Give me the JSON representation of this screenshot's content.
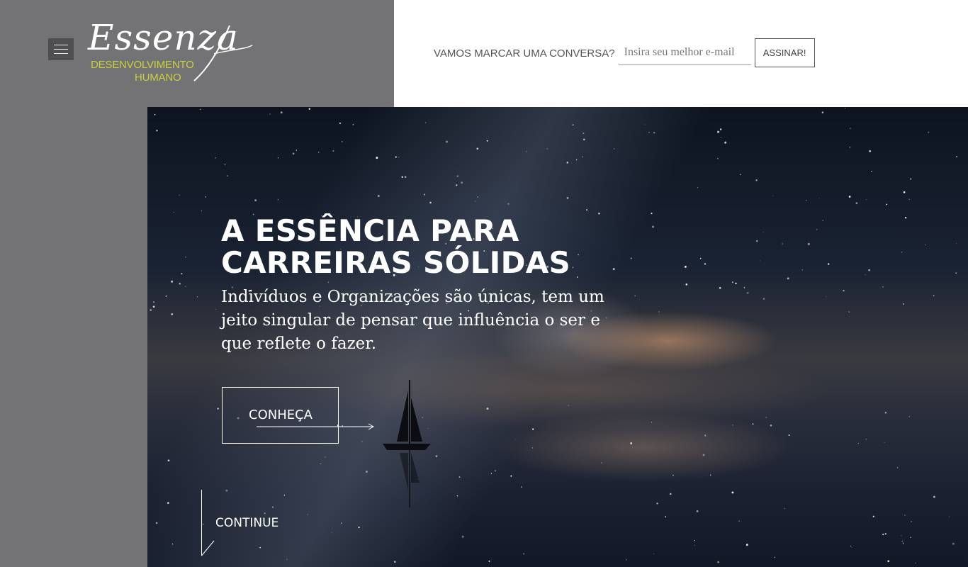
{
  "header": {
    "menu_icon": "hamburger-menu-icon",
    "logo": {
      "script_text": "Essenza",
      "subtitle_line1": "DESENVOLVIMENTO",
      "subtitle_line2": "HUMANO",
      "subtitle_color": "#c7d23a"
    }
  },
  "newsletter": {
    "label": "VAMOS MARCAR UMA CONVERSA?",
    "placeholder": "Insira seu melhor e-mail",
    "button_label": "ASSINAR!"
  },
  "hero": {
    "title_line1": "A ESSÊNCIA PARA",
    "title_line2": "CARREIRAS SÓLIDAS",
    "subtitle": "Indivíduos e Organizações são únicas, tem um jeito singular de pensar que influência o ser e que reflete o fazer.",
    "cta_label": "CONHEÇA",
    "continue_label": "CONTINUE"
  },
  "colors": {
    "left_panel": "#737375",
    "menu_button": "#4f4f51",
    "accent": "#c7d23a"
  }
}
